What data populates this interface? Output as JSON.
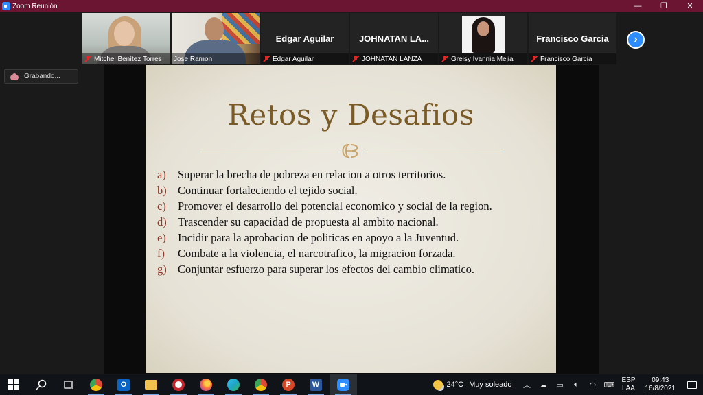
{
  "window": {
    "title": "Zoom Reunión",
    "minimize": "—",
    "restore": "❐",
    "close": "✕"
  },
  "participants": [
    {
      "name": "Mitchel Benítez Torres",
      "video": true,
      "muted": true,
      "active": false
    },
    {
      "name": "Jose Ramon",
      "video": true,
      "muted": false,
      "active": true
    },
    {
      "name": "Edgar Aguilar",
      "display": "Edgar Aguilar",
      "video": false,
      "muted": true
    },
    {
      "name": "JOHNATAN LANZA",
      "display": "JOHNATAN  LA...",
      "video": false,
      "muted": true
    },
    {
      "name": "Greisy Ivannia Mejia",
      "video": true,
      "muted": true
    },
    {
      "name": "Francisco Garcia",
      "display": "Francisco Garcia",
      "video": false,
      "muted": true
    }
  ],
  "strip": {
    "next_label": "›"
  },
  "recording": {
    "label": "Grabando..."
  },
  "slide": {
    "title": "Retos y Desafios",
    "items": [
      {
        "letter": "a)",
        "text": "Superar la brecha de pobreza en relacion a otros territorios."
      },
      {
        "letter": "b)",
        "text": "Continuar fortaleciendo el tejido social."
      },
      {
        "letter": "c)",
        "text": "Promover el desarrollo del potencial economico y social de la region."
      },
      {
        "letter": "d)",
        "text": "Trascender su capacidad de  propuesta al ambito nacional."
      },
      {
        "letter": "e)",
        "text": "Incidir para la aprobacion de politicas en apoyo a la Juventud."
      },
      {
        "letter": "f)",
        "text": "Combate a la violencia, el narcotrafico, la migracion forzada."
      },
      {
        "letter": "g)",
        "text": "Conjuntar esfuerzo para superar los efectos del cambio climatico."
      }
    ]
  },
  "taskbar": {
    "apps": [
      {
        "name": "start",
        "icon": "windows-icon"
      },
      {
        "name": "search",
        "icon": "search-icon"
      },
      {
        "name": "task-view",
        "icon": "task-view-icon"
      },
      {
        "name": "chrome",
        "icon": "chrome-icon",
        "color": "#dd4b39"
      },
      {
        "name": "outlook",
        "icon": "outlook-icon",
        "color": "#0a64c8"
      },
      {
        "name": "file-explorer",
        "icon": "folder-icon",
        "color": "#f2c14e"
      },
      {
        "name": "app-red",
        "icon": "app-icon",
        "color": "#c4262e"
      },
      {
        "name": "firefox",
        "icon": "firefox-icon",
        "color": "#ff7139"
      },
      {
        "name": "edge",
        "icon": "edge-icon",
        "color": "#1fa5c9"
      },
      {
        "name": "chrome-profile",
        "icon": "chrome-icon",
        "color": "#3aa757"
      },
      {
        "name": "powerpoint",
        "icon": "powerpoint-icon",
        "color": "#d24726"
      },
      {
        "name": "word",
        "icon": "word-icon",
        "color": "#2b579a"
      },
      {
        "name": "zoom",
        "icon": "zoom-icon",
        "color": "#2d8cff"
      }
    ],
    "weather": {
      "temp": "24°C",
      "desc": "Muy soleado"
    },
    "language": {
      "line1": "ESP",
      "line2": "LAA"
    },
    "clock": {
      "time": "09:43",
      "date": "16/8/2021"
    }
  }
}
